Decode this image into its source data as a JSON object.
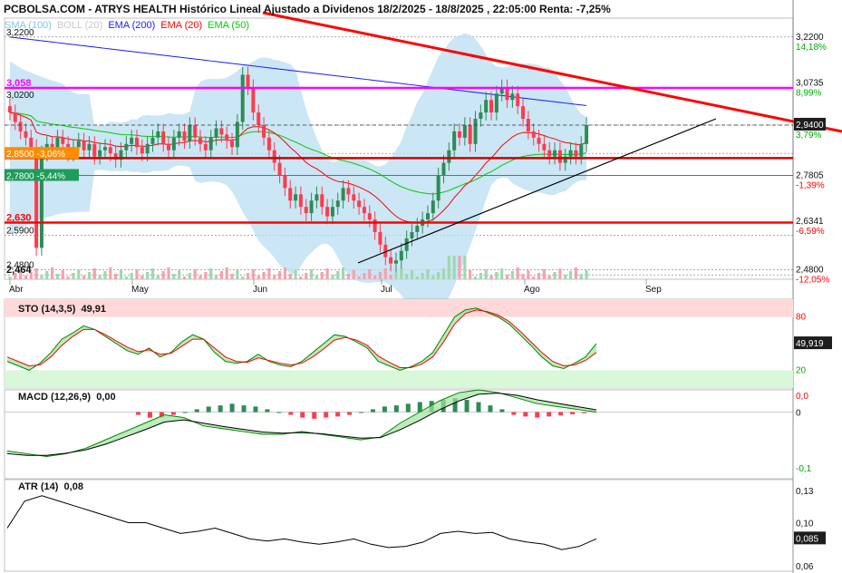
{
  "header": {
    "title": "PCBOLSA.COM - ATRYS HEALTH Histórico Lineal Ajustado a Dividenos 18/2/2025 - 18/8/2025 , 22:05:00 Renta: -7,25%"
  },
  "legend": [
    {
      "label": "SMA (100)",
      "color": "#7ec8e3"
    },
    {
      "label": "BOLL (20)",
      "color": "#c8c8c8"
    },
    {
      "label": "EMA (200)",
      "color": "#1a1aff"
    },
    {
      "label": "EMA (20)",
      "color": "#ff0000"
    },
    {
      "label": "EMA (50)",
      "color": "#00cc00"
    }
  ],
  "colors": {
    "up": "#2e8b57",
    "down": "#ff3b4e",
    "boll_fill": "#b9def2",
    "trend_red": "#ff0000",
    "magenta": "#ff00ff",
    "orange": "#ff8c00",
    "green_label": "#1e9c5a"
  },
  "price_axis_labels": [
    {
      "value": "3,2200",
      "pct": "14,18%",
      "y": 3.22,
      "pct_color": "#00aa00"
    },
    {
      "value": "3,0735",
      "pct": "8,99%",
      "y": 3.0735,
      "pct_color": "#00aa00"
    },
    {
      "value": "2,9400",
      "pct": "3,79%",
      "y": 2.94,
      "pct_color": "#00aa00",
      "boxed": true
    },
    {
      "value": "2,7805",
      "pct": "-1,39%",
      "y": 2.7805,
      "pct_color": "#ff0000"
    },
    {
      "value": "2,6341",
      "pct": "-6,59%",
      "y": 2.6341,
      "pct_color": "#ff0000"
    },
    {
      "value": "2,4800",
      "pct": "-12,05%",
      "y": 2.48,
      "pct_color": "#ff0000"
    }
  ],
  "left_labels": [
    {
      "text": "3,2200",
      "y": 3.22,
      "color": "#111"
    },
    {
      "text": "3,058",
      "y": 3.058,
      "color": "#ff00ff",
      "bold": true
    },
    {
      "text": "3,0200",
      "y": 3.02,
      "color": "#111"
    },
    {
      "text": "2,8500 -3,06%",
      "y": 2.85,
      "color": "#ffffff",
      "bg": "#ff8c00"
    },
    {
      "text": "2,7800 -5,44%",
      "y": 2.78,
      "color": "#ffffff",
      "bg": "#1e9c5a"
    },
    {
      "text": "2,630",
      "y": 2.63,
      "color": "#ff0000",
      "bold": true
    },
    {
      "text": "2,5900",
      "y": 2.59,
      "color": "#111"
    },
    {
      "text": "2,4800",
      "y": 2.48,
      "color": "#111"
    },
    {
      "text": "2,464",
      "y": 2.464,
      "color": "#111",
      "bold": true
    }
  ],
  "x_axis_labels": [
    "Abr",
    "May",
    "Jun",
    "Jul",
    "Ago",
    "Sep"
  ],
  "sto": {
    "label": "STO (14,3,5)",
    "value": "49,91",
    "level_high": "80",
    "level_low": "20",
    "current": "49,919"
  },
  "macd": {
    "label": "MACD (12,26,9)",
    "value": "0,00",
    "ticks": [
      "0,0",
      "0",
      "-0,1"
    ]
  },
  "atr": {
    "label": "ATR (14)",
    "value": "0,08",
    "ticks": [
      "0,13",
      "0,10",
      "0,06"
    ],
    "current": "0,085"
  },
  "chart_data": [
    {
      "type": "candlestick",
      "title": "ATRYS HEALTH",
      "x_range": [
        "2025-03-31",
        "2025-09-08"
      ],
      "ylim": [
        2.45,
        3.28
      ],
      "grid": true,
      "horizontal_levels": [
        3.22,
        3.058,
        2.94,
        2.85,
        2.78,
        2.63,
        2.59,
        2.48,
        2.464
      ],
      "close": [
        2.98,
        2.95,
        2.92,
        2.9,
        2.87,
        2.55,
        2.85,
        2.88,
        2.86,
        2.9,
        2.88,
        2.85,
        2.87,
        2.89,
        2.86,
        2.88,
        2.84,
        2.86,
        2.87,
        2.85,
        2.83,
        2.86,
        2.88,
        2.9,
        2.87,
        2.85,
        2.88,
        2.9,
        2.92,
        2.88,
        2.86,
        2.9,
        2.92,
        2.89,
        2.94,
        2.9,
        2.88,
        2.86,
        2.9,
        2.93,
        2.91,
        2.89,
        2.87,
        2.95,
        3.1,
        3.06,
        2.98,
        2.94,
        2.9,
        2.86,
        2.82,
        2.78,
        2.74,
        2.7,
        2.72,
        2.68,
        2.66,
        2.7,
        2.72,
        2.68,
        2.65,
        2.68,
        2.7,
        2.74,
        2.72,
        2.7,
        2.68,
        2.66,
        2.64,
        2.6,
        2.56,
        2.52,
        2.5,
        2.51,
        2.54,
        2.58,
        2.6,
        2.62,
        2.64,
        2.66,
        2.7,
        2.78,
        2.82,
        2.86,
        2.92,
        2.9,
        2.94,
        2.88,
        2.96,
        2.98,
        3.02,
        2.98,
        3.04,
        3.06,
        3.02,
        3.04,
        3.0,
        2.96,
        2.92,
        2.9,
        2.88,
        2.86,
        2.84,
        2.86,
        2.82,
        2.84,
        2.86,
        2.84,
        2.88,
        2.94
      ]
    },
    {
      "type": "line",
      "title": "STO (14,3,5)",
      "ylim": [
        0,
        100
      ],
      "series": [
        {
          "name": "STO (14,3,5)",
          "values": [
            30,
            25,
            20,
            28,
            40,
            55,
            62,
            70,
            66,
            58,
            50,
            42,
            38,
            45,
            35,
            40,
            52,
            60,
            55,
            40,
            30,
            28,
            30,
            38,
            30,
            26,
            24,
            30,
            40,
            50,
            60,
            58,
            52,
            45,
            30,
            25,
            20,
            24,
            30,
            40,
            60,
            80,
            88,
            90,
            85,
            80,
            72,
            60,
            48,
            35,
            25,
            22,
            28,
            35,
            50
          ]
        },
        {
          "name": "",
          "values": [
            35,
            30,
            25,
            26,
            35,
            48,
            58,
            66,
            66,
            60,
            53,
            46,
            41,
            43,
            38,
            39,
            47,
            55,
            55,
            45,
            35,
            30,
            29,
            34,
            31,
            28,
            26,
            28,
            35,
            44,
            54,
            57,
            54,
            48,
            36,
            29,
            23,
            23,
            27,
            35,
            52,
            72,
            84,
            88,
            86,
            82,
            75,
            64,
            52,
            40,
            30,
            25,
            26,
            31,
            40
          ]
        }
      ]
    },
    {
      "type": "bar",
      "title": "MACD (12,26,9)",
      "ylim": [
        -0.12,
        0.04
      ],
      "histogram": [
        -0.005,
        -0.01,
        -0.01,
        -0.005,
        0,
        0.005,
        0.01,
        0.012,
        0.015,
        0.012,
        0.01,
        0.005,
        0,
        -0.005,
        -0.01,
        -0.012,
        -0.01,
        -0.008,
        -0.005,
        0,
        0.005,
        0.01,
        0.012,
        0.015,
        0.018,
        0.02,
        0.022,
        0.025,
        0.022,
        0.018,
        0.012,
        0.005,
        -0.005,
        -0.008,
        -0.01,
        -0.008,
        -0.006,
        -0.004,
        -0.002
      ],
      "series": [
        {
          "name": "MACD (12,26,9)",
          "values": [
            -0.07,
            -0.075,
            -0.08,
            -0.075,
            -0.065,
            -0.05,
            -0.035,
            -0.02,
            -0.005,
            -0.01,
            -0.025,
            -0.03,
            -0.035,
            -0.04,
            -0.04,
            -0.035,
            -0.04,
            -0.045,
            -0.05,
            -0.045,
            -0.02,
            0.0,
            0.02,
            0.035,
            0.04,
            0.035,
            0.025,
            0.015,
            0.01,
            0.005,
            0.0
          ]
        },
        {
          "name": "",
          "values": [
            -0.075,
            -0.078,
            -0.078,
            -0.074,
            -0.068,
            -0.058,
            -0.045,
            -0.032,
            -0.018,
            -0.014,
            -0.02,
            -0.026,
            -0.031,
            -0.036,
            -0.038,
            -0.037,
            -0.039,
            -0.043,
            -0.047,
            -0.046,
            -0.032,
            -0.015,
            0.004,
            0.02,
            0.032,
            0.034,
            0.03,
            0.022,
            0.016,
            0.01,
            0.004
          ]
        }
      ]
    },
    {
      "type": "line",
      "title": "ATR (14)",
      "ylim": [
        0.055,
        0.14
      ],
      "series": [
        {
          "name": "ATR (14)",
          "values": [
            0.095,
            0.12,
            0.125,
            0.12,
            0.115,
            0.11,
            0.105,
            0.1,
            0.1,
            0.095,
            0.09,
            0.092,
            0.095,
            0.09,
            0.085,
            0.083,
            0.085,
            0.082,
            0.08,
            0.082,
            0.085,
            0.08,
            0.077,
            0.078,
            0.082,
            0.09,
            0.092,
            0.09,
            0.091,
            0.085,
            0.082,
            0.08,
            0.075,
            0.078,
            0.085
          ]
        }
      ]
    }
  ]
}
